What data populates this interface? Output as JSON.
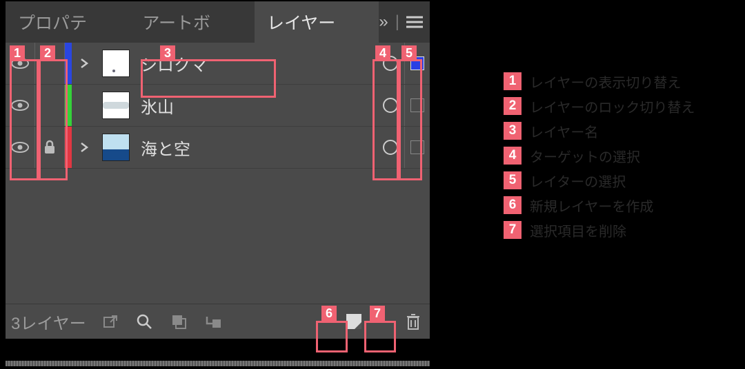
{
  "tabs": {
    "properties": "プロパテ",
    "artboard": "アートボ",
    "layers": "レイヤー"
  },
  "layers": [
    {
      "name": "シロクマ",
      "color": "#2a46e0",
      "locked": false,
      "expandable": true,
      "thumb": "polar",
      "selected": true
    },
    {
      "name": "氷山",
      "color": "#35d23a",
      "locked": false,
      "expandable": false,
      "thumb": "clouds",
      "selected": false
    },
    {
      "name": "海と空",
      "color": "#e23742",
      "locked": true,
      "expandable": true,
      "thumb": "seasky",
      "selected": false
    }
  ],
  "footer": {
    "count_label": "3レイヤー"
  },
  "annotations": {
    "1": "レイヤーの表示切り替え",
    "2": "レイヤーのロック切り替え",
    "3": "レイヤー名",
    "4": "ターゲットの選択",
    "5": "レイターの選択",
    "6": "新規レイヤーを作成",
    "7": "選択項目を削除"
  },
  "colors": {
    "accent": "#f06272"
  }
}
